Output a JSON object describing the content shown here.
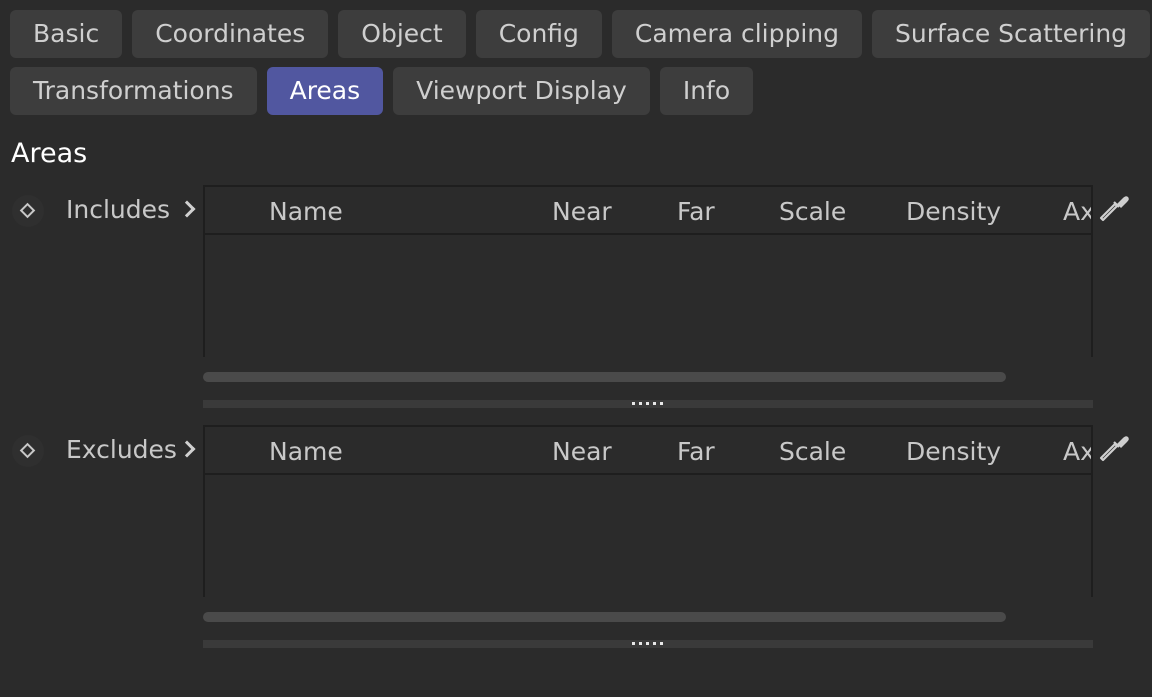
{
  "tabs": {
    "row1": [
      "Basic",
      "Coordinates",
      "Object",
      "Config",
      "Camera clipping",
      "Surface Scattering"
    ],
    "row2": [
      "Transformations",
      "Areas",
      "Viewport Display",
      "Info"
    ],
    "active": "Areas"
  },
  "section": {
    "title": "Areas"
  },
  "includes": {
    "label": "Includes",
    "columns": [
      "Name",
      "Near",
      "Far",
      "Scale",
      "Density",
      "Ax"
    ],
    "rows": []
  },
  "excludes": {
    "label": "Excludes",
    "columns": [
      "Name",
      "Near",
      "Far",
      "Scale",
      "Density",
      "Ax"
    ],
    "rows": []
  },
  "icons": {
    "animate": "diamond-keyframe-icon",
    "expand": "chevron-right-icon",
    "picker": "eyedropper-icon",
    "resize": "grip-dots-icon"
  },
  "colors": {
    "background": "#2b2b2b",
    "tab": "#3d3d3d",
    "tab_active": "#5157a0"
  }
}
